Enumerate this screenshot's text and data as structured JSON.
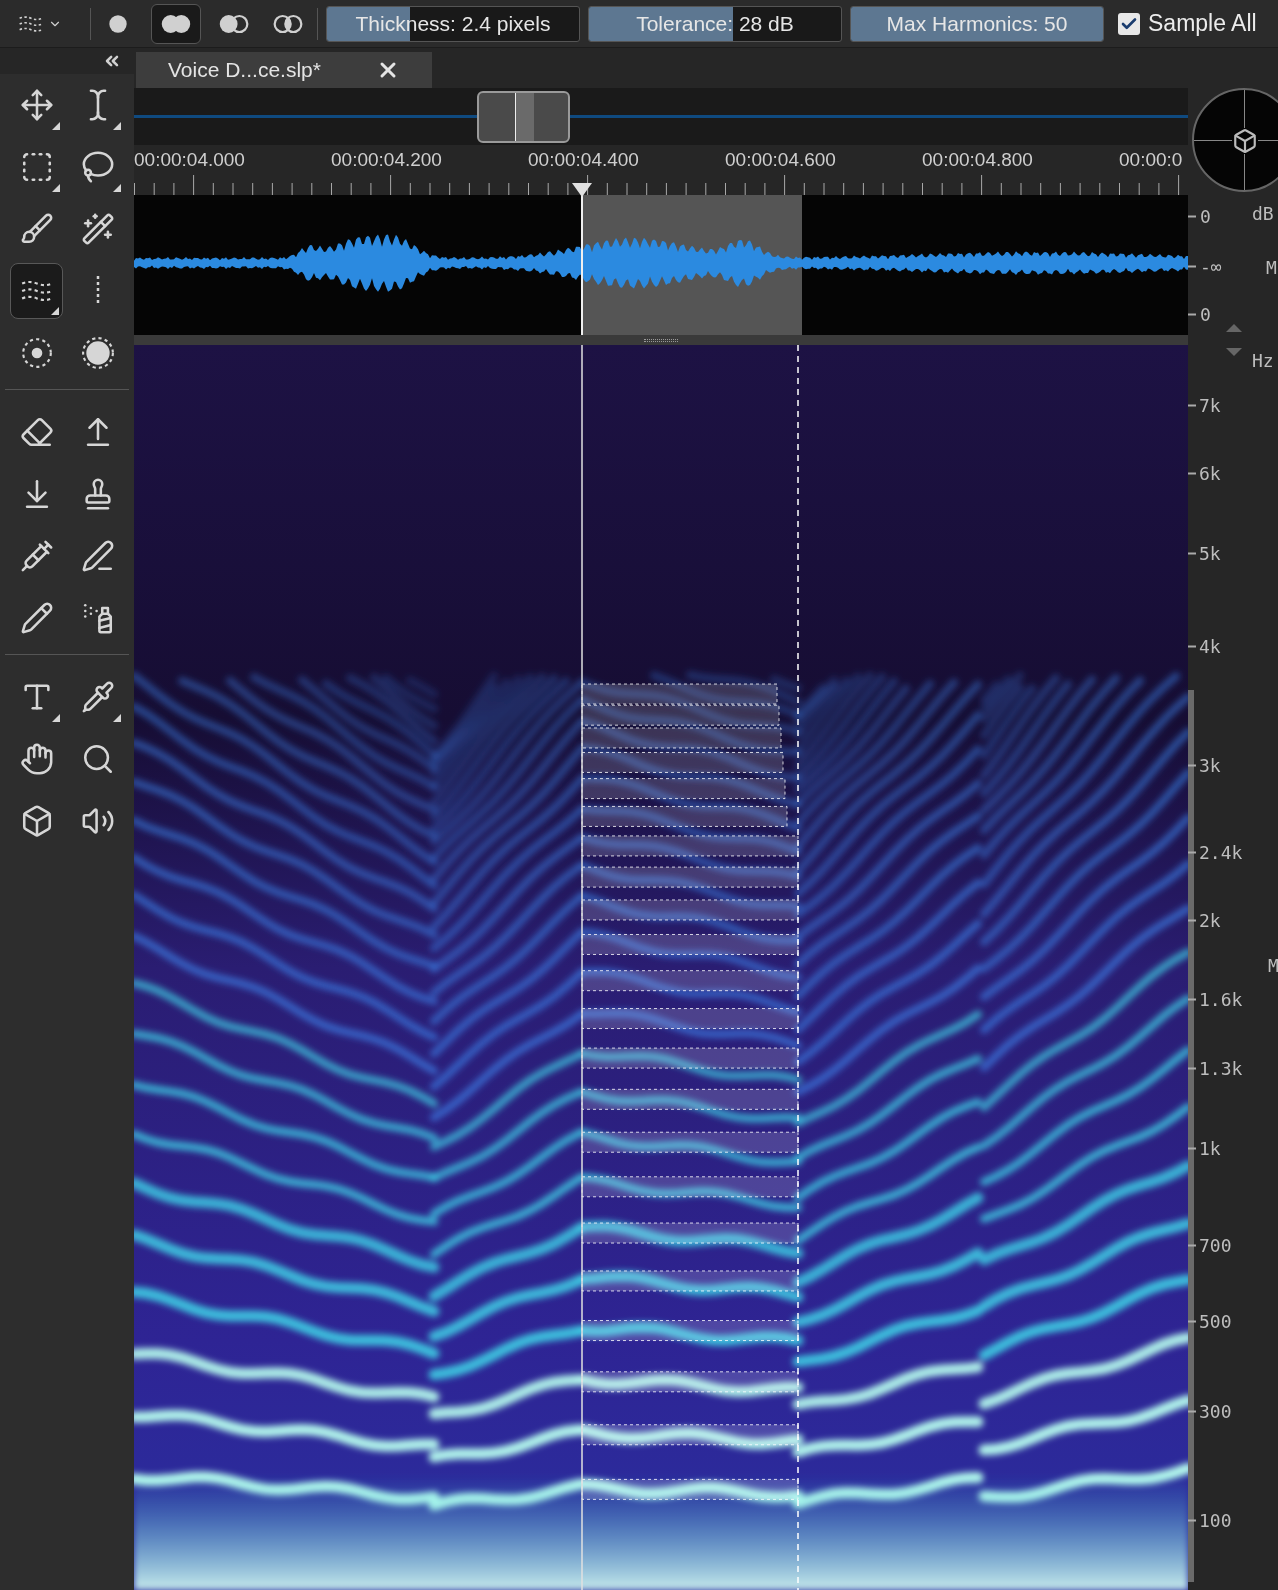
{
  "toolbar": {
    "modes": [
      {
        "selected": false
      },
      {
        "selected": true
      },
      {
        "selected": false
      },
      {
        "selected": false
      }
    ],
    "fields": [
      {
        "text": "Thickness: 2.4 pixels",
        "level": 0.33
      },
      {
        "text": "Tolerance: 28 dB",
        "level": 0.57
      },
      {
        "text": "Max Harmonics: 50",
        "level": 1
      }
    ],
    "sample_all": {
      "label": "Sample All",
      "checked": true
    }
  },
  "tool_groups": [
    {
      "tools": [
        {
          "selected": false,
          "submenu": true
        },
        {
          "selected": false,
          "submenu": true
        },
        {
          "selected": false,
          "submenu": true
        },
        {
          "selected": false,
          "submenu": true
        },
        {
          "selected": false,
          "submenu": false
        },
        {
          "selected": false,
          "submenu": false
        },
        {
          "selected": true,
          "submenu": true
        },
        {
          "selected": false,
          "submenu": false
        },
        {
          "selected": false,
          "submenu": false
        },
        {
          "selected": false,
          "submenu": false
        }
      ]
    },
    {
      "tools": [
        {
          "selected": false,
          "submenu": false
        },
        {
          "selected": false,
          "submenu": false
        },
        {
          "selected": false,
          "submenu": false
        },
        {
          "selected": false,
          "submenu": false
        },
        {
          "selected": false,
          "submenu": false
        },
        {
          "selected": false,
          "submenu": false
        },
        {
          "selected": false,
          "submenu": false
        },
        {
          "selected": false,
          "submenu": false
        }
      ]
    },
    {
      "tools": [
        {
          "selected": false,
          "submenu": true
        },
        {
          "selected": false,
          "submenu": true
        },
        {
          "selected": false,
          "submenu": false
        },
        {
          "selected": false,
          "submenu": false
        },
        {
          "selected": false,
          "submenu": false
        },
        {
          "selected": false,
          "submenu": false
        }
      ]
    }
  ],
  "tab": {
    "label": "Voice D...ce.slp*"
  },
  "time_ruler": {
    "labels": [
      "00:00:04.000",
      "00:00:04.200",
      "00:00:04.400",
      "00:00:04.600",
      "00:00:04.800",
      "00:00:0"
    ]
  },
  "waveform_scale": {
    "unit": "dB",
    "labels": [
      "0",
      "-∞",
      "0"
    ],
    "meter_label": "M"
  },
  "spectrogram_scale": {
    "unit": "Hz",
    "labels": [
      "7k",
      "6k",
      "5k",
      "4k",
      "3k",
      "2.4k",
      "2k",
      "1.6k",
      "1.3k",
      "1k",
      "700",
      "500",
      "300",
      "100"
    ],
    "meter_label": "M"
  }
}
